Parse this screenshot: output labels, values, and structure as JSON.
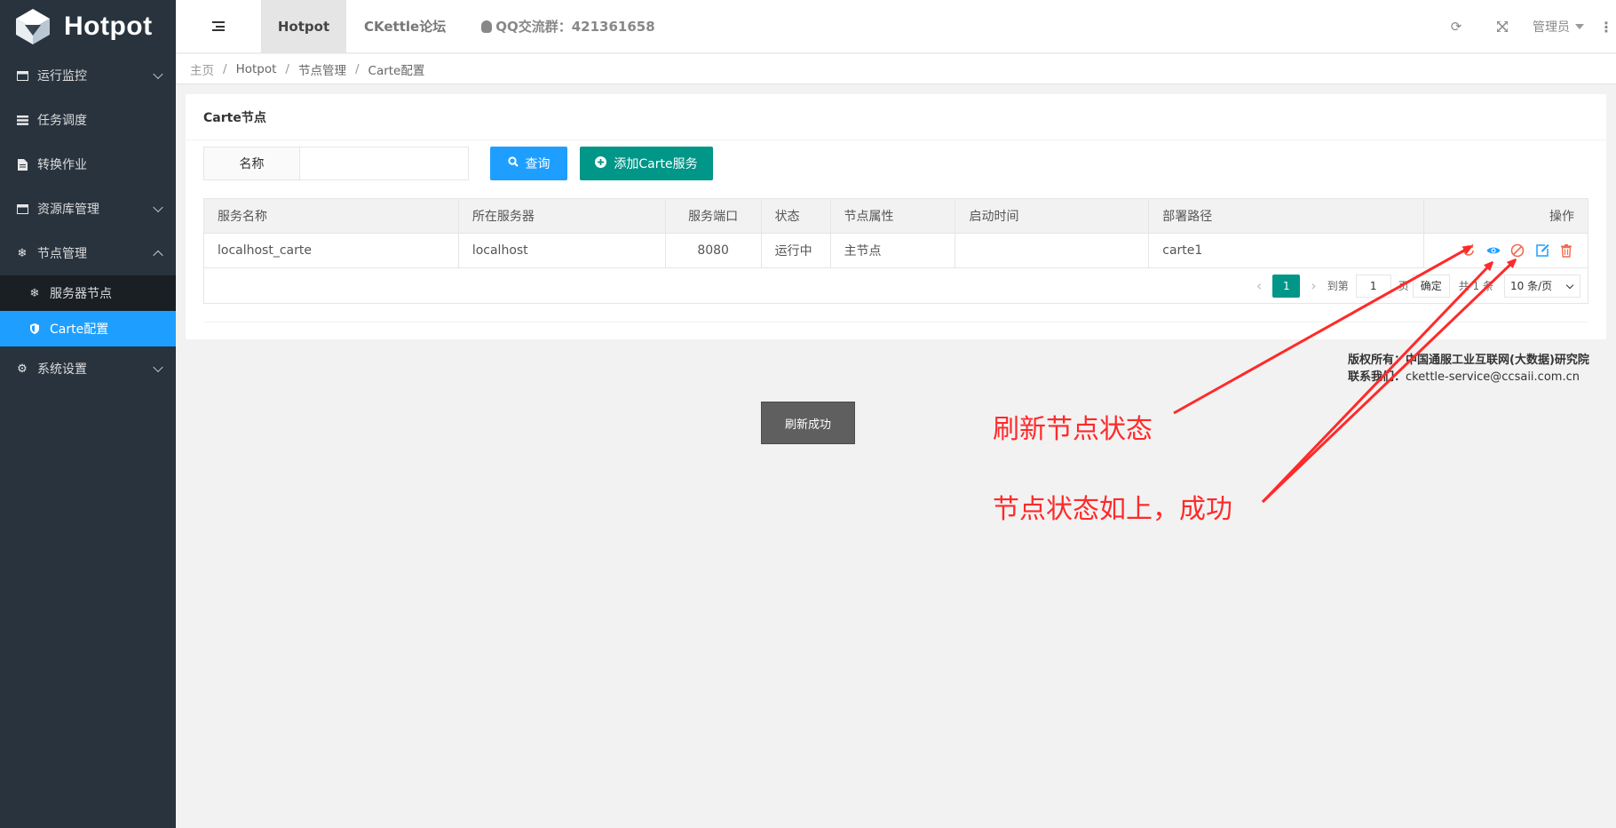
{
  "app": {
    "logo_text": "Hotpot"
  },
  "sidebar": {
    "items": [
      {
        "label": "运行监控",
        "icon": "window-icon"
      },
      {
        "label": "任务调度",
        "icon": "list-icon"
      },
      {
        "label": "转换作业",
        "icon": "file-icon"
      },
      {
        "label": "资源库管理",
        "icon": "window-icon"
      },
      {
        "label": "节点管理",
        "icon": "snowflake-icon"
      },
      {
        "label": "系统设置",
        "icon": "gears-icon"
      }
    ],
    "sub_items": [
      {
        "label": "服务器节点",
        "icon": "snowflake-icon"
      },
      {
        "label": "Carte配置",
        "icon": "shield-icon"
      }
    ]
  },
  "header": {
    "tabs": [
      "Hotpot",
      "CKettle论坛"
    ],
    "qq": "QQ交流群：421361658",
    "admin": "管理员"
  },
  "breadcrumb": [
    "主页",
    "Hotpot",
    "节点管理",
    "Carte配置"
  ],
  "card": {
    "title": "Carte节点",
    "search_label": "名称",
    "search_value": "",
    "query_button": "查询",
    "add_button": "添加Carte服务"
  },
  "table": {
    "columns": [
      "服务名称",
      "所在服务器",
      "服务端口",
      "状态",
      "节点属性",
      "启动时间",
      "部署路径",
      "操作"
    ],
    "rows": [
      [
        "localhost_carte",
        "localhost",
        "8080",
        "运行中",
        "主节点",
        "",
        "carte1"
      ]
    ]
  },
  "pager": {
    "current_page": "1",
    "goto_label": "到第",
    "goto_value": "1",
    "page_suffix": "页",
    "confirm": "确定",
    "total": "共 1 条",
    "per_page": "10 条/页"
  },
  "copyright": {
    "line1_label": "版权所有：",
    "line1_value": "中国通服工业互联网(大数据)研究院",
    "line2_label": "联系我们：",
    "line2_value": "ckettle-service@ccsaii.com.cn"
  },
  "toast": "刷新成功",
  "annotations": {
    "refresh_note": "刷新节点状态",
    "status_note": "节点状态如上，成功"
  },
  "colors": {
    "sidebar_bg": "#28333e",
    "active_blue": "#1e9fff",
    "green": "#009688",
    "annotation_red": "#ff2a2a"
  }
}
